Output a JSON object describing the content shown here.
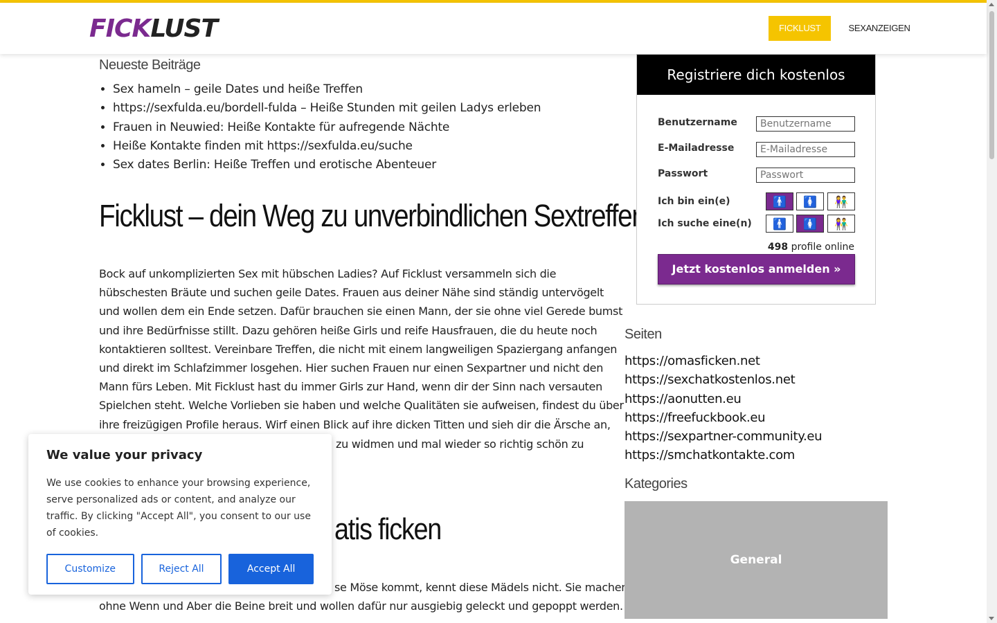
{
  "header": {
    "logo_part1": "FICK",
    "logo_part2": "LUST",
    "nav": [
      {
        "label": "FICKLUST"
      },
      {
        "label": "SEXANZEIGEN"
      }
    ]
  },
  "recent_posts": {
    "title": "Neueste Beiträge",
    "items": [
      "Sex hameln – geile Dates und heiße Treffen",
      "https://sexfulda.eu/bordell-fulda – Heiße Stunden mit geilen Ladys erleben",
      "Frauen in Neuwied: Heiße Kontakte für aufregende Nächte",
      "Heiße Kontakte finden mit https://sexfulda.eu/suche",
      "Sex dates Berlin: Heiße Treffen und erotische Abenteuer"
    ]
  },
  "article": {
    "h1": "Ficklust – dein Weg zu unverbindlichen Sextreffen",
    "paragraph1": "Bock auf unkomplizierten Sex mit hübschen Ladies? Auf Ficklust versammeln sich die hübschesten Bräute und suchen geile Dates. Frauen aus deiner Nähe sind ständig untervögelt und wollen dem ein Ende setzen. Dafür brauchen sie einen Mann, der sie ohne viel Gerede bumst und ihre Bedürfnisse stillt. Dazu gehören heiße Girls und reife Hausfrauen, die du heute noch kontaktieren solltest. Vereinbare Treffen, die nicht mit einem langweiligen Spaziergang anfangen und direkt im Schlafzimmer losgehen. Hier suchen Frauen nur einen Sexpartner und nicht den Mann fürs Leben. Mit Ficklust hast du immer Girls zur Hand, wenn dir der Sinn nach versauten Spielchen steht. Welche Vorlieben sie haben und welche Qualitäten sie aufweisen, findest du über ihre freizügigen Profile heraus. Wirf einen Blick auf ihre dicken Titten und sieh dir die Ärsche an, die schon bald durch deine",
    "paragraph1_tail": "zu widmen und mal wieder so richtig schön zu",
    "h2_tail": "atis ficken",
    "paragraph2_line1_tail": "se Möse kommt, kennt diese Mädels nicht. Sie machen",
    "paragraph2_line2": "ohne Wenn und Aber die Beine breit und wollen dafür nur ausgiebig geleckt und gepoppt werden."
  },
  "registration": {
    "title": "Registriere dich kostenlos",
    "username_label": "Benutzername",
    "username_placeholder": "Benutzername",
    "email_label": "E-Mailadresse",
    "email_placeholder": "E-Mailadresse",
    "password_label": "Passwort",
    "password_placeholder": "Passwort",
    "iam_label": "Ich bin ein(e)",
    "seek_label": "Ich suche eine(n)",
    "online_count": "498",
    "online_text": "profile online",
    "signup_label": "Jetzt kostenlos anmelden »",
    "iam_selected": "male",
    "seek_selected": "female"
  },
  "sidebar": {
    "pages_title": "Seiten",
    "pages": [
      "https://omasficken.net",
      "https://sexchatkostenlos.net",
      "https://aonutten.eu",
      "https://freefuckbook.eu",
      "https://sexpartner-community.eu",
      "https://smchatkontakte.com"
    ],
    "categories_title": "Kategories",
    "category": "General"
  },
  "cookie": {
    "title": "We value your privacy",
    "text": "We use cookies to enhance your browsing experience, serve personalized ads or content, and analyze our traffic. By clicking \"Accept All\", you consent to our use of cookies.",
    "customize": "Customize",
    "reject": "Reject All",
    "accept": "Accept All"
  },
  "colors": {
    "accent_yellow": "#f5c400",
    "brand_purple": "#7b2a8f",
    "cookie_blue": "#1863dc"
  }
}
